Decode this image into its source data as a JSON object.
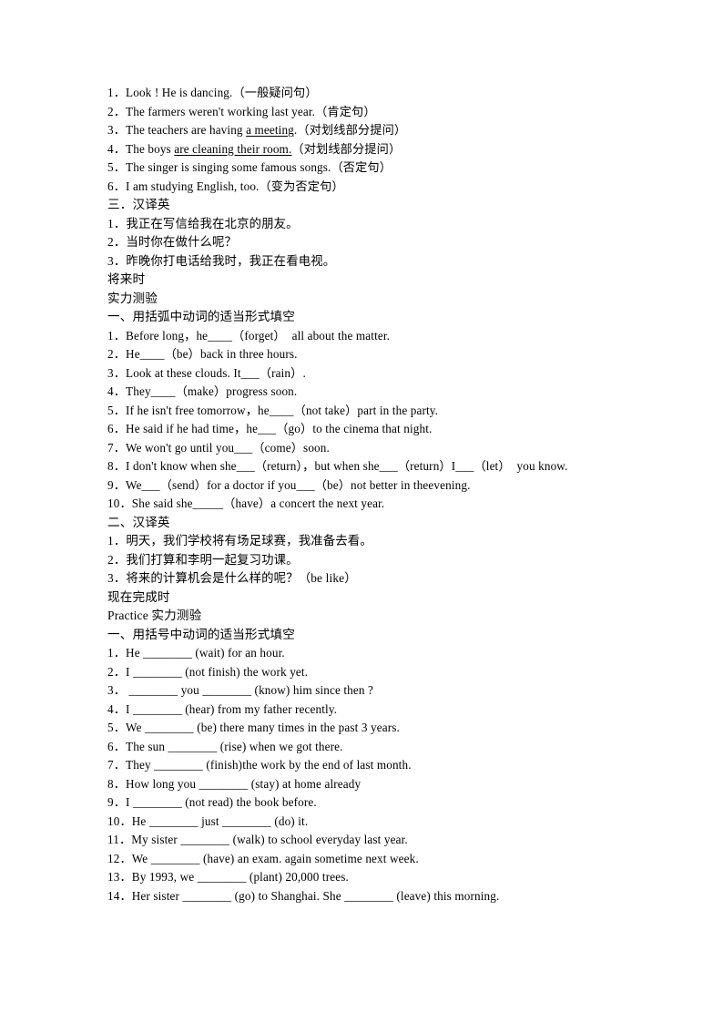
{
  "document": {
    "page_background": "#ffffff",
    "text_color": "#000000",
    "sections": [
      {
        "id": "present-continuous-rewrite",
        "lines": [
          {
            "id": "pc-1",
            "script": "mixed",
            "text": "1．Look ! He is dancing.（一般疑问句）"
          },
          {
            "id": "pc-2",
            "script": "mixed",
            "text": "2．The farmers weren't working last year.（肯定句）"
          },
          {
            "id": "pc-3",
            "script": "mixed",
            "pre": "3．The teachers are having ",
            "underlined": "a meeting",
            "post": ".（对划线部分提问）"
          },
          {
            "id": "pc-4",
            "script": "mixed",
            "pre": "4．The boys ",
            "underlined": "are cleaning their room.",
            "post": "（对划线部分提问）"
          },
          {
            "id": "pc-5",
            "script": "mixed",
            "text": "5．The singer is singing some famous songs.（否定句）"
          },
          {
            "id": "pc-6",
            "script": "mixed",
            "text": "6．I am studying English, too.（变为否定句）"
          }
        ]
      },
      {
        "id": "translate-cn-to-en-3",
        "heading": "三．汉译英",
        "lines": [
          {
            "id": "t3-1",
            "script": "cn",
            "text": "1．我正在写信给我在北京的朋友。"
          },
          {
            "id": "t3-2",
            "script": "cn",
            "text": "2．当时你在做什么呢？"
          },
          {
            "id": "t3-3",
            "script": "cn",
            "text": "3．昨晚你打电话给我时，我正在看电视。"
          }
        ]
      },
      {
        "id": "future-tense",
        "title": "将来时",
        "subtitle": "实力测验",
        "heading": "一、用括弧中动词的适当形式填空",
        "lines": [
          {
            "id": "ft-1",
            "script": "mixed",
            "text": "1．Before long，he____（forget）  all about the matter."
          },
          {
            "id": "ft-2",
            "script": "mixed",
            "text": "2．He____（be）back in three hours."
          },
          {
            "id": "ft-3",
            "script": "mixed",
            "text": "3．Look at these clouds. It___（rain）."
          },
          {
            "id": "ft-4",
            "script": "mixed",
            "text": "4．They____（make）progress soon."
          },
          {
            "id": "ft-5",
            "script": "mixed",
            "text": "5．If he isn't free tomorrow，he____（not take）part in the party."
          },
          {
            "id": "ft-6",
            "script": "mixed",
            "text": "6．He said if he had time，he___（go）to the cinema that night."
          },
          {
            "id": "ft-7",
            "script": "mixed",
            "text": "7．We won't go until you___（come）soon."
          },
          {
            "id": "ft-8",
            "script": "mixed",
            "text": "8．I don't know when she___（return），but when she___（return）I___（let）  you know."
          },
          {
            "id": "ft-9",
            "script": "mixed",
            "text": "9．We___（send）for a doctor if you___（be）not better in theevening."
          },
          {
            "id": "ft-10",
            "script": "mixed",
            "text": "10．She said she_____（have）a concert the next year."
          }
        ]
      },
      {
        "id": "translate-cn-to-en-2",
        "heading": "二、汉译英",
        "lines": [
          {
            "id": "t2-1",
            "script": "cn",
            "text": "1．明天，我们学校将有场足球赛，我准备去看。"
          },
          {
            "id": "t2-2",
            "script": "cn",
            "text": "2．我们打算和李明一起复习功课。"
          },
          {
            "id": "t2-3",
            "script": "cn",
            "text": "3．将来的计算机会是什么样的呢？（be like）"
          }
        ]
      },
      {
        "id": "present-perfect",
        "title": "现在完成时",
        "subtitle": "Practice 实力测验",
        "heading": "一、用括号中动词的适当形式填空",
        "lines": [
          {
            "id": "pp-1",
            "script": "mixed",
            "text": "1．He ________ (wait) for an hour."
          },
          {
            "id": "pp-2",
            "script": "mixed",
            "text": "2．I ________ (not finish) the work yet."
          },
          {
            "id": "pp-3",
            "script": "mixed",
            "text": "3． ________ you ________ (know) him since then ?"
          },
          {
            "id": "pp-4",
            "script": "mixed",
            "text": "4．I ________ (hear) from my father recently."
          },
          {
            "id": "pp-5",
            "script": "mixed",
            "text": "5．We ________ (be) there many times in the past 3 years."
          },
          {
            "id": "pp-6",
            "script": "mixed",
            "text": "6．The sun ________ (rise) when we got there."
          },
          {
            "id": "pp-7",
            "script": "mixed",
            "text": "7．They ________ (finish)the work by the end of last month."
          },
          {
            "id": "pp-8",
            "script": "mixed",
            "text": "8．How long you ________ (stay) at home already"
          },
          {
            "id": "pp-9",
            "script": "mixed",
            "text": "9．I ________ (not read) the book before."
          },
          {
            "id": "pp-10",
            "script": "mixed",
            "text": "10．He ________ just ________ (do) it."
          },
          {
            "id": "pp-11",
            "script": "mixed",
            "text": "11．My sister ________ (walk) to school everyday last year."
          },
          {
            "id": "pp-12",
            "script": "mixed",
            "text": "12．We ________ (have) an exam. again sometime next week."
          },
          {
            "id": "pp-13",
            "script": "mixed",
            "text": "13．By 1993, we ________ (plant) 20,000 trees."
          },
          {
            "id": "pp-14",
            "script": "mixed",
            "text": "14．Her sister ________ (go) to Shanghai. She ________ (leave) this morning."
          }
        ]
      }
    ]
  }
}
